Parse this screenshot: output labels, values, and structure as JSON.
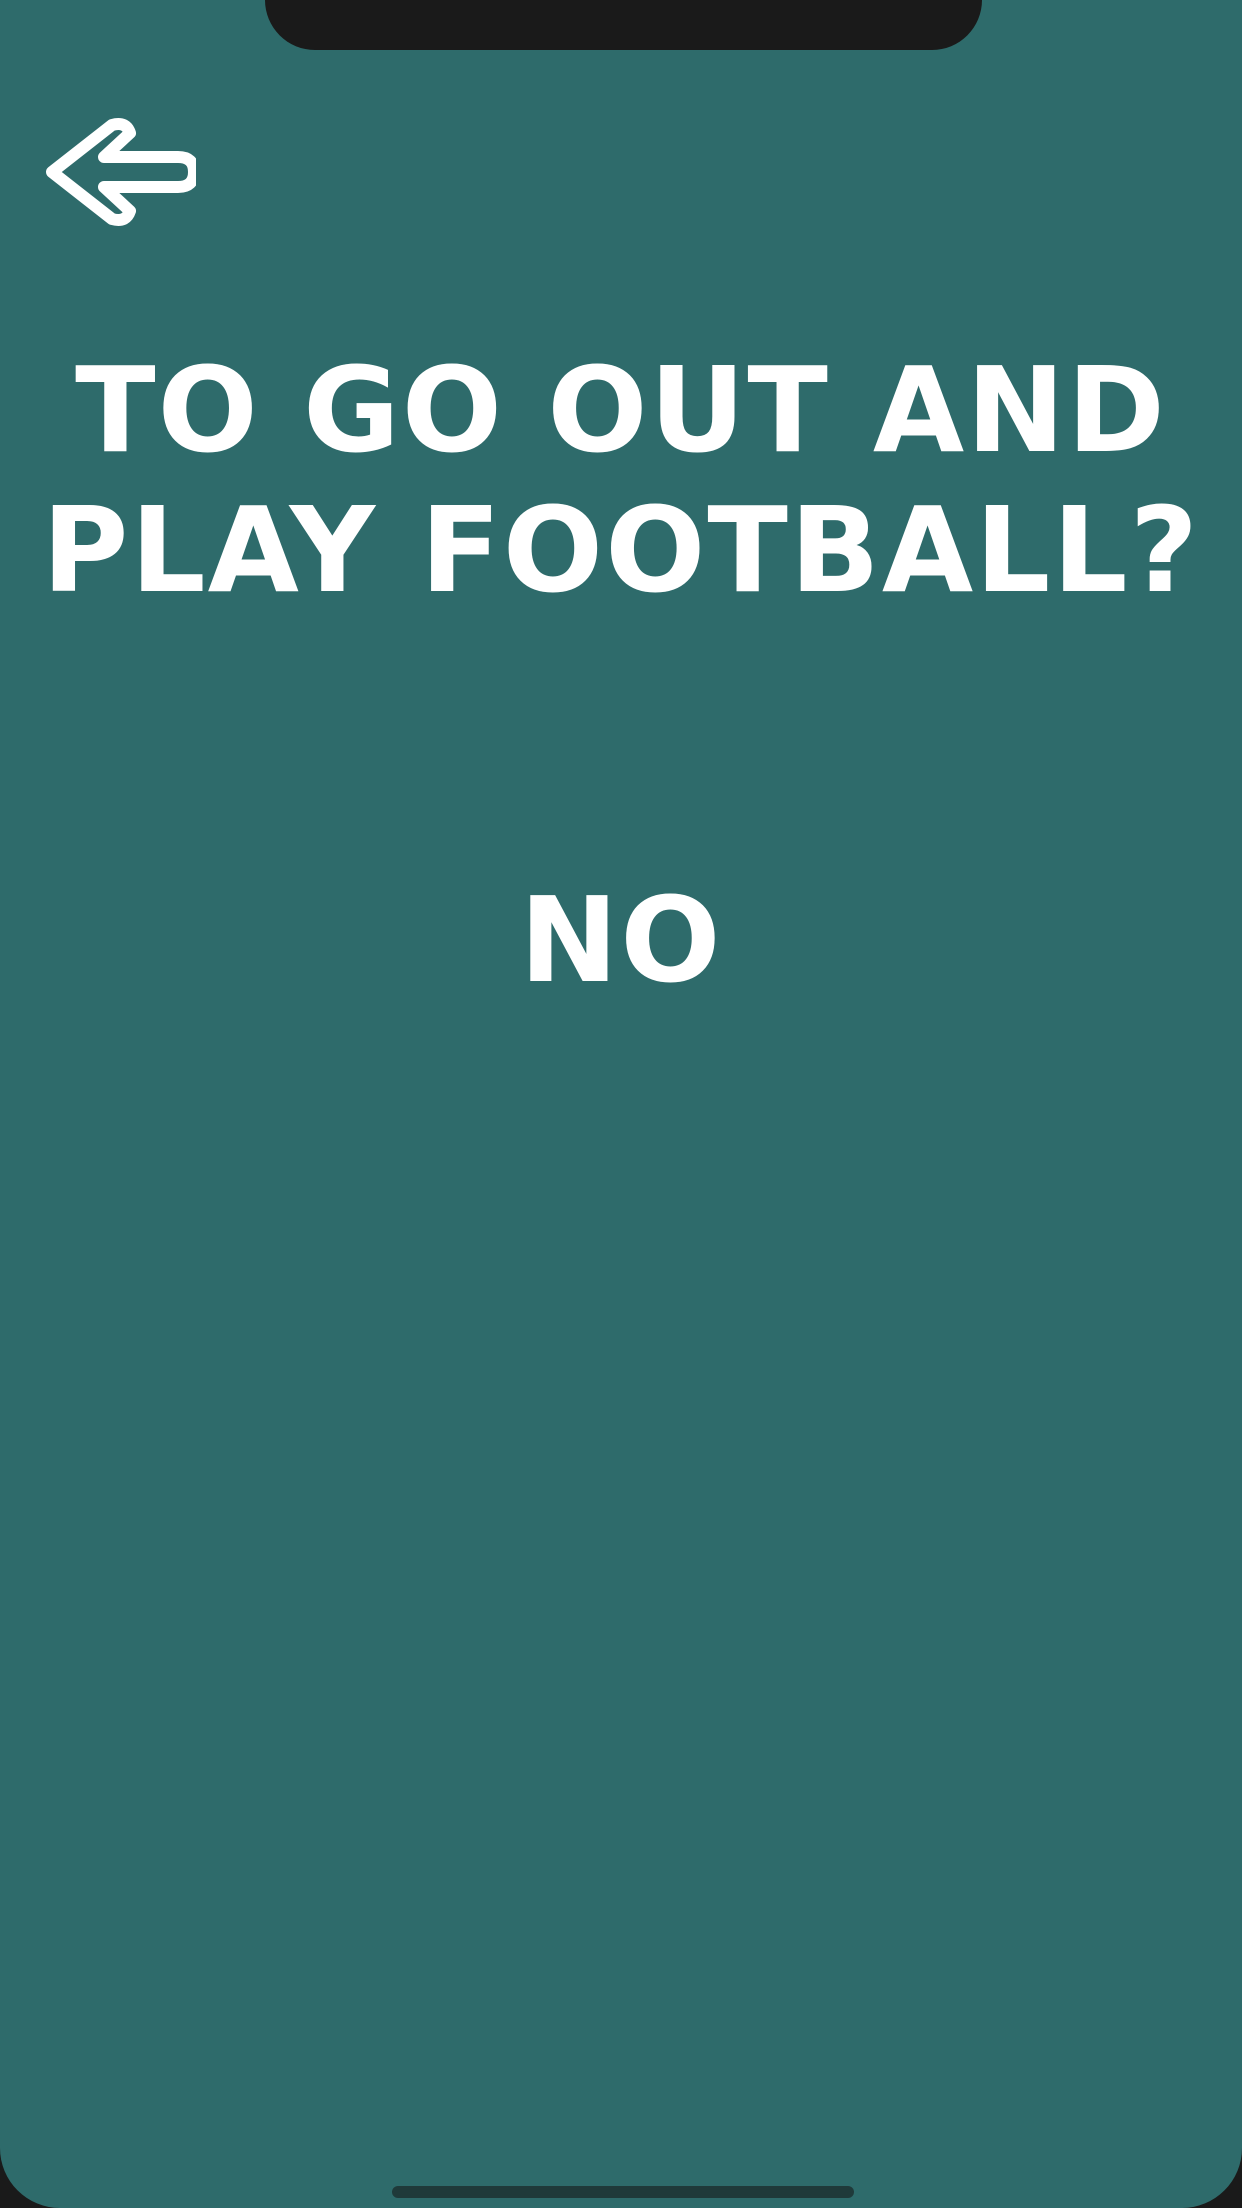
{
  "theme": {
    "background": "#2e6b6b",
    "text_color": "#ffffff"
  },
  "header": {
    "back_icon": "arrow-left-icon"
  },
  "main": {
    "question": "TO GO OUT AND PLAY FOOTBALL?",
    "answer": "NO"
  }
}
